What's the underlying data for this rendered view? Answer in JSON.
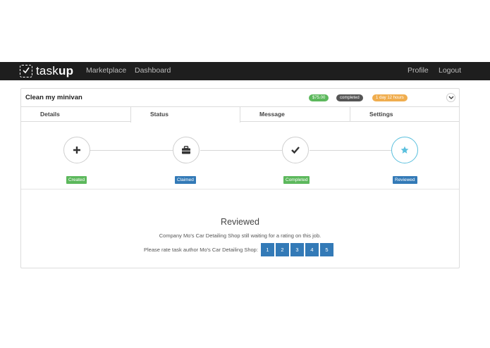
{
  "navbar": {
    "brand": {
      "prefix": "task",
      "suffix": "up"
    },
    "links": {
      "marketplace": "Marketplace",
      "dashboard": "Dashboard",
      "profile": "Profile",
      "logout": "Logout"
    }
  },
  "task": {
    "title": "Clean my minivan",
    "price": "$75.00",
    "status": "completed",
    "duration": "1 day 12 hours"
  },
  "tabs": {
    "details": "Details",
    "status": "Status",
    "message": "Message",
    "settings": "Settings"
  },
  "steps": [
    {
      "label": "Created",
      "icon": "plus-icon",
      "color": "#5cb85c"
    },
    {
      "label": "Claimed",
      "icon": "briefcase-icon",
      "color": "#337ab7"
    },
    {
      "label": "Completed",
      "icon": "check-icon",
      "color": "#5cb85c"
    },
    {
      "label": "Reviewed",
      "icon": "star-icon",
      "color": "#337ab7"
    }
  ],
  "review": {
    "title": "Reviewed",
    "message": "Company Mo's Car Detailing Shop still waiting for a rating on this job.",
    "rate_prompt": "Please rate task author Mo's Car Detailing Shop:",
    "ratings": [
      "1",
      "2",
      "3",
      "4",
      "5"
    ]
  },
  "colors": {
    "navbar": "#1e1e1e",
    "success": "#5cb85c",
    "primary": "#337ab7",
    "warning": "#f0ad4e",
    "info": "#5bc0de"
  }
}
